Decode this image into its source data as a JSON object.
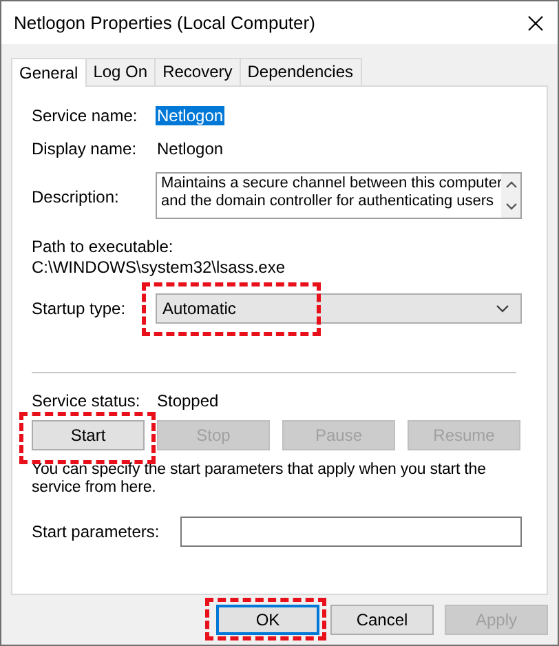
{
  "window": {
    "title": "Netlogon Properties (Local Computer)"
  },
  "tabs": [
    {
      "label": "General",
      "selected": true
    },
    {
      "label": "Log On",
      "selected": false
    },
    {
      "label": "Recovery",
      "selected": false
    },
    {
      "label": "Dependencies",
      "selected": false
    }
  ],
  "service_name": {
    "label": "Service name:",
    "value": "Netlogon",
    "selected": true
  },
  "display_name": {
    "label": "Display name:",
    "value": "Netlogon"
  },
  "description": {
    "label": "Description:",
    "lines": [
      "Maintains a secure channel between this computer",
      "and the domain controller for authenticating users"
    ]
  },
  "path": {
    "label": "Path to executable:",
    "value": "C:\\WINDOWS\\system32\\lsass.exe"
  },
  "startup_type": {
    "label": "Startup type:",
    "value": "Automatic",
    "highlighted": true
  },
  "service_status": {
    "label": "Service status:",
    "value": "Stopped"
  },
  "control_buttons": [
    {
      "label": "Start",
      "disabled": false,
      "highlighted": true
    },
    {
      "label": "Stop",
      "disabled": true,
      "highlighted": false
    },
    {
      "label": "Pause",
      "disabled": true,
      "highlighted": false
    },
    {
      "label": "Resume",
      "disabled": true,
      "highlighted": false
    }
  ],
  "note": "You can specify the start parameters that apply when you start the service from here.",
  "start_parameters": {
    "label": "Start parameters:"
  },
  "dialog_buttons": [
    {
      "label": "OK",
      "disabled": false,
      "default": true,
      "highlighted": true
    },
    {
      "label": "Cancel",
      "disabled": false,
      "default": false,
      "highlighted": false
    },
    {
      "label": "Apply",
      "disabled": true,
      "default": false,
      "highlighted": false
    }
  ]
}
